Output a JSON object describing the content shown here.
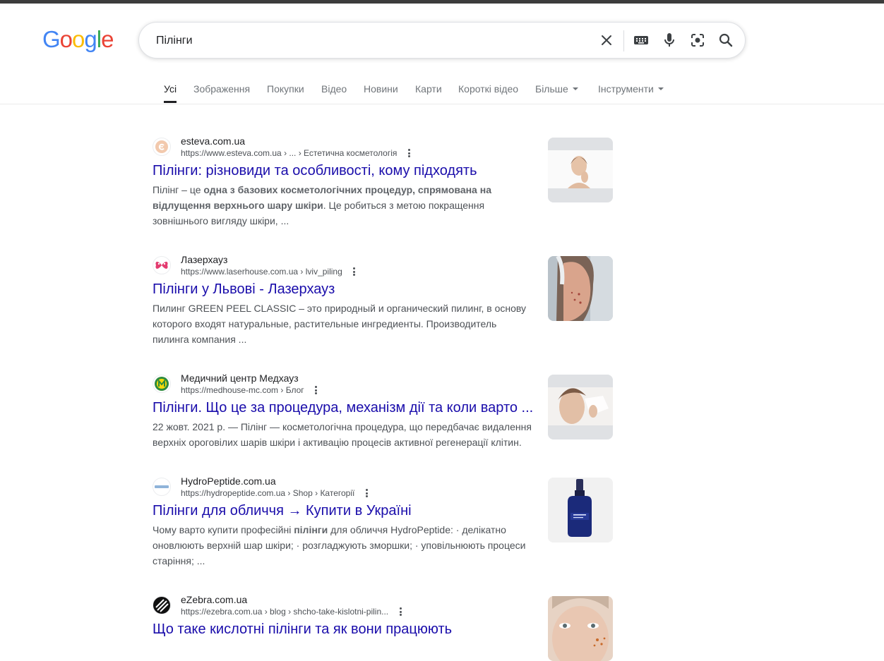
{
  "logo": {
    "letters": [
      "G",
      "o",
      "o",
      "g",
      "l",
      "e"
    ],
    "colors": [
      "#4285F4",
      "#EA4335",
      "#FBBC05",
      "#4285F4",
      "#34A853",
      "#EA4335"
    ]
  },
  "search": {
    "query": "Пілінги"
  },
  "icons": [
    "clear-icon",
    "keyboard-icon",
    "microphone-icon",
    "google-lens-icon",
    "search-icon"
  ],
  "tabs": [
    "Усі",
    "Зображення",
    "Покупки",
    "Відео",
    "Новини",
    "Карти",
    "Короткі відео",
    "Більше",
    "Інструменти"
  ],
  "results": [
    {
      "site": "esteva.com.ua",
      "url": "https://www.esteva.com.ua › ... › Естетична косметологія",
      "title": "Пілінги: різновиди та особливості, кому підходять",
      "snippet_parts": [
        "Пілінг – це ",
        "одна з базових косметологічних процедур, спрямована на відлущення верхнього шару шкіри",
        ". Це робиться з метою покращення зовнішнього вигляду шкіри, ..."
      ]
    },
    {
      "site": "Лазерхауз",
      "url": "https://www.laserhouse.com.ua › lviv_piling",
      "title": "Пілінги у Львові - Лазерхауз",
      "snippet": "Пилинг GREEN PEEL CLASSIC – это природный и органический пилинг, в основу которого входят натуральные, растительные ингредиенты. Производитель пилинга компания ..."
    },
    {
      "site": "Медичний центр Медхауз",
      "url": "https://medhouse-mc.com › Блог",
      "title": "Пілінги. Що це за процедура, механізм дії та коли варто ...",
      "snippet": "22 жовт. 2021 р. — Пілінг — косметологічна процедура, що передбачає видалення верхніх ороговілих шарів шкіри і активацію процесів активної регенерації клітин."
    },
    {
      "site": "HydroPeptide.com.ua",
      "url": "https://hydropeptide.com.ua › Shop › Категорії",
      "title": "Пілінги для обличчя → Купити в Україні",
      "snippet_parts": [
        "Чому варто купити професійні ",
        "пілінги",
        " для обличчя HydroPeptide: · делікатно оновлюють верхній шар шкіри; · розгладжують зморшки; · уповільнюють процеси старіння; ..."
      ]
    },
    {
      "site": "eZebra.com.ua",
      "url": "https://ezebra.com.ua › blog › shcho-take-kislotni-pilin...",
      "title": "Що таке кислотні пілінги та як вони працюють",
      "snippet": ""
    }
  ]
}
